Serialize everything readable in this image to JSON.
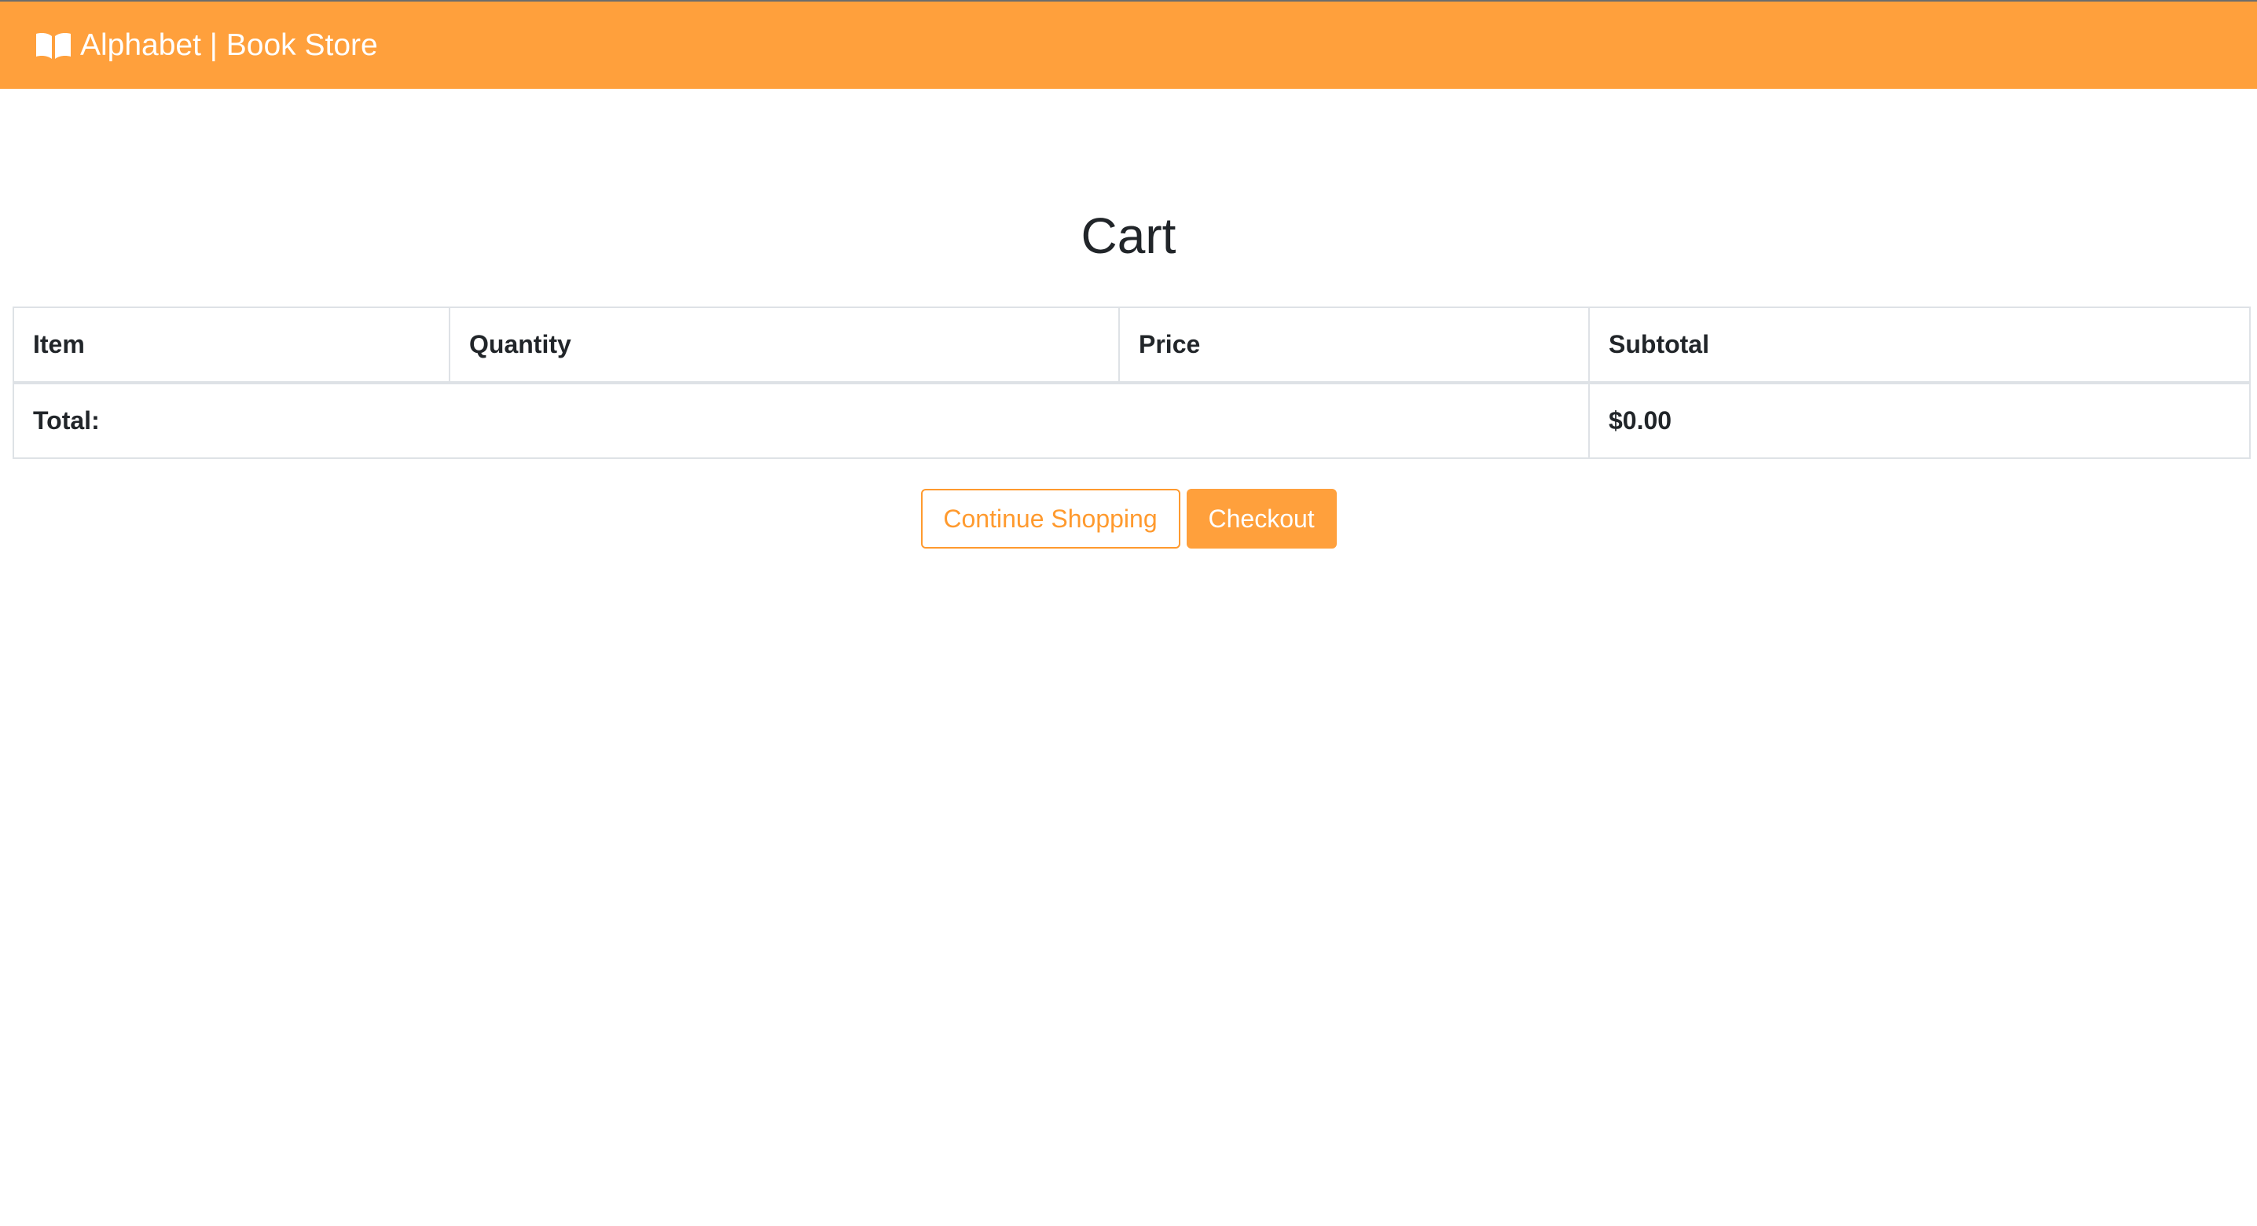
{
  "navbar": {
    "brand_icon": "open-book-icon",
    "brand_text": "Alphabet | Book Store",
    "color": "#ffa03c"
  },
  "page": {
    "title": "Cart"
  },
  "cart_table": {
    "headers": [
      "Item",
      "Quantity",
      "Price",
      "Subtotal"
    ],
    "total_label": "Total:",
    "total_value": "$0.00"
  },
  "actions": {
    "continue_label": "Continue Shopping",
    "checkout_label": "Checkout"
  }
}
